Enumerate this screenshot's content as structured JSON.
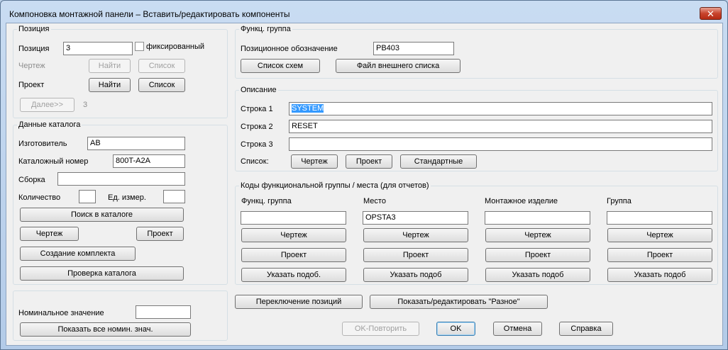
{
  "window": {
    "title": "Компоновка монтажной панели – Вставить/редактировать компоненты",
    "close_glyph": "✕"
  },
  "position": {
    "group_title": "Позиция",
    "position_label": "Позиция",
    "position_value": "3",
    "fixed_label": "фиксированный",
    "drawing_label": "Чертеж",
    "project_label": "Проект",
    "find_label": "Найти",
    "list_label": "Список",
    "next_label": "Далее>>",
    "next_value": "3"
  },
  "catalog": {
    "group_title": "Данные каталога",
    "manufacturer_label": "Изготовитель",
    "manufacturer_value": "AB",
    "catalog_number_label": "Каталожный номер",
    "catalog_number_value": "800T-A2A",
    "assembly_label": "Сборка",
    "assembly_value": "",
    "quantity_label": "Количество",
    "quantity_value": "",
    "unit_label": "Ед. измер.",
    "unit_value": "",
    "catalog_search_label": "Поиск в каталоге",
    "drawing_label": "Чертеж",
    "project_label": "Проект",
    "create_kit_label": "Создание комплекта",
    "check_catalog_label": "Проверка каталога"
  },
  "nominal": {
    "label": "Номинальное значение",
    "value": "",
    "show_all_label": "Показать все номин. знач."
  },
  "func_group": {
    "group_title": "Функц. группа",
    "tag_label": "Позиционное обозначение",
    "tag_value": "PB403",
    "schematic_list_label": "Список схем",
    "external_file_label": "Файл внешнего списка"
  },
  "description": {
    "group_title": "Описание",
    "line1_label": "Строка 1",
    "line1_value": "SYSTEM",
    "line2_label": "Строка 2",
    "line2_value": "RESET",
    "line3_label": "Строка 3",
    "line3_value": "",
    "list_label": "Список:",
    "drawing_label": "Чертеж",
    "project_label": "Проект",
    "standard_label": "Стандартные"
  },
  "codes": {
    "group_title": "Коды функциональной группы / места (для отчетов)",
    "columns": [
      {
        "header": "Функц. группа",
        "value": "",
        "drawing": "Чертеж",
        "project": "Проект",
        "pick": "Указать подоб."
      },
      {
        "header": "Место",
        "value": "OPSTA3",
        "drawing": "Чертеж",
        "project": "Проект",
        "pick": "Указать подоб"
      },
      {
        "header": "Монтажное изделие",
        "value": "",
        "drawing": "Чертеж",
        "project": "Проект",
        "pick": "Указать подоб"
      },
      {
        "header": "Группа",
        "value": "",
        "drawing": "Чертеж",
        "project": "Проект",
        "pick": "Указать подоб"
      }
    ]
  },
  "footer": {
    "switch_positions_label": "Переключение позиций",
    "show_misc_label": "Показать/редактировать \"Разное\"",
    "ok_repeat_label": "OK-Повторить",
    "ok_label": "OK",
    "cancel_label": "Отмена",
    "help_label": "Справка"
  }
}
